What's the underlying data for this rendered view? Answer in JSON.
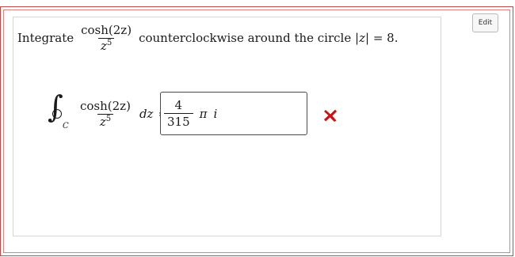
{
  "edit_button": {
    "label": "Edit"
  },
  "prompt": {
    "verb": "Integrate",
    "fraction": {
      "numerator": "cosh(2z)",
      "denominator_base": "z",
      "denominator_exp": "5"
    },
    "tail_text": "counterclockwise around the circle",
    "abs_open": "|",
    "abs_var": "z",
    "abs_close": "|",
    "equals": "=",
    "value": "8."
  },
  "answer_expression": {
    "contour_label": "C",
    "fraction": {
      "numerator": "cosh(2z)",
      "denominator_base": "z",
      "denominator_exp": "5"
    },
    "differential": "dz",
    "equals": "="
  },
  "answer_input": {
    "numerator": "4",
    "denominator": "315",
    "pi_symbol": "π",
    "imag_unit": "i"
  },
  "feedback": {
    "icon": "cross-icon",
    "status": "incorrect",
    "color": "#cc1111"
  },
  "colors": {
    "outer_border": "#c04a4a",
    "inner_border": "#d98080",
    "card_border": "#d6d6d6"
  }
}
